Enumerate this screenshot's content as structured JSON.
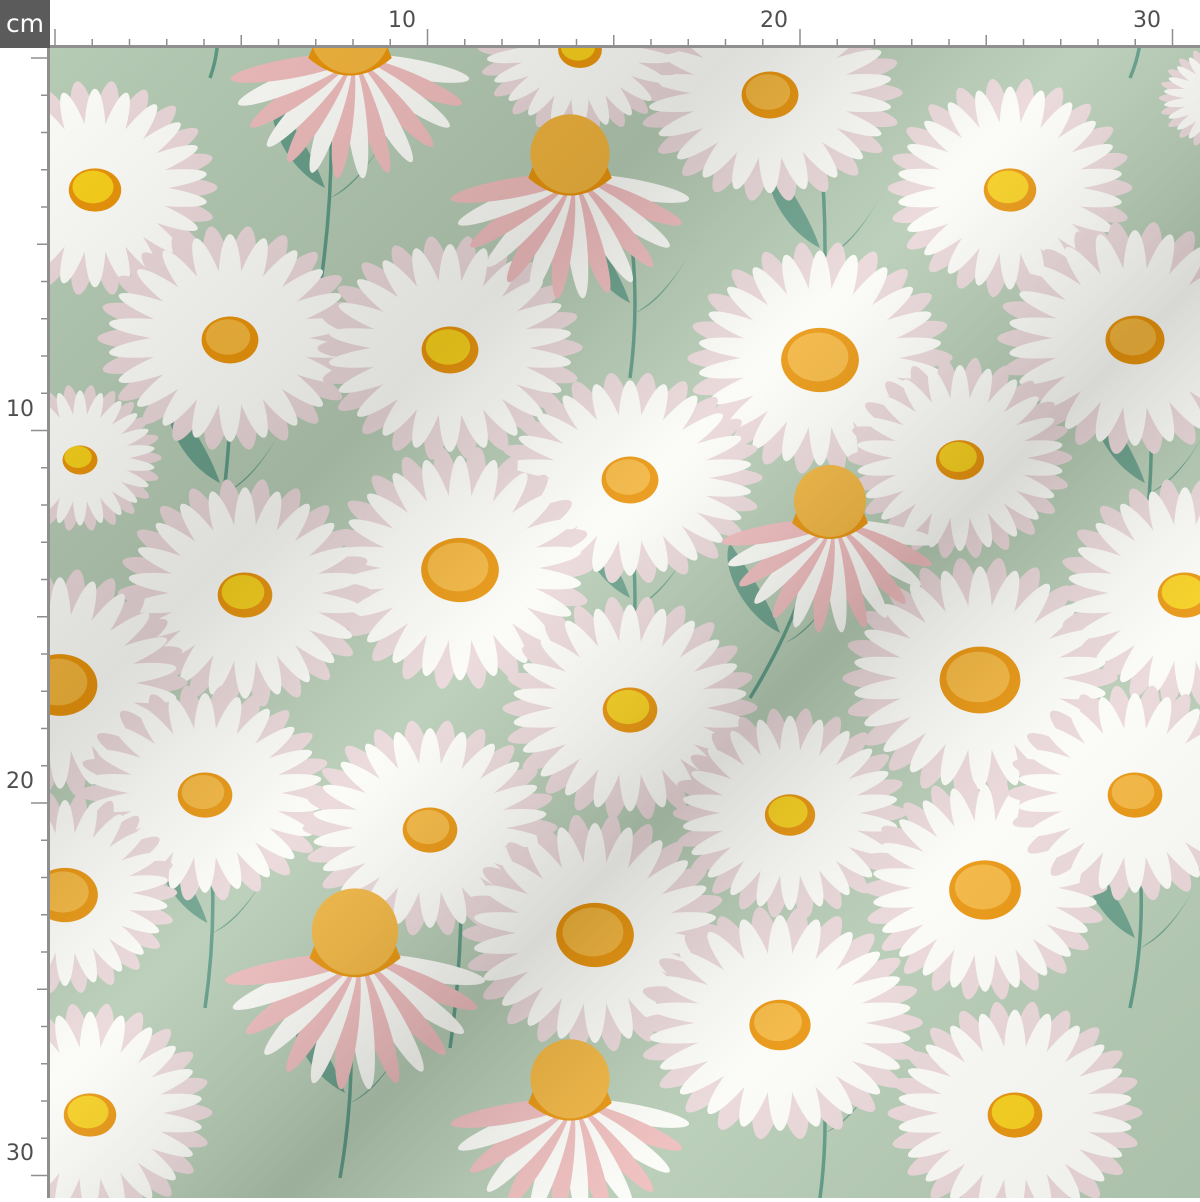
{
  "ruler": {
    "unit_label": "cm",
    "top_labels": [
      "10",
      "20",
      "30"
    ],
    "left_labels": [
      "10",
      "20",
      "30"
    ]
  },
  "colors": {
    "fabric_background": "#b5cbb4",
    "petal_white": "#fbfbf7",
    "petal_pink": "#ead7d9",
    "petal_rose": "#eebcbc",
    "center_orange": "#e8940c",
    "center_yellow": "#f6cf1c",
    "stem_green": "#5e9a85",
    "leaf_green": "#6aa08b",
    "ruler_text": "#4f4f4f",
    "unit_badge": "#5b5b5b"
  },
  "icons": {
    "unit_badge": "centimeter-unit-badge"
  },
  "fabric": {
    "motif": "daisy",
    "flower_count": 41
  }
}
